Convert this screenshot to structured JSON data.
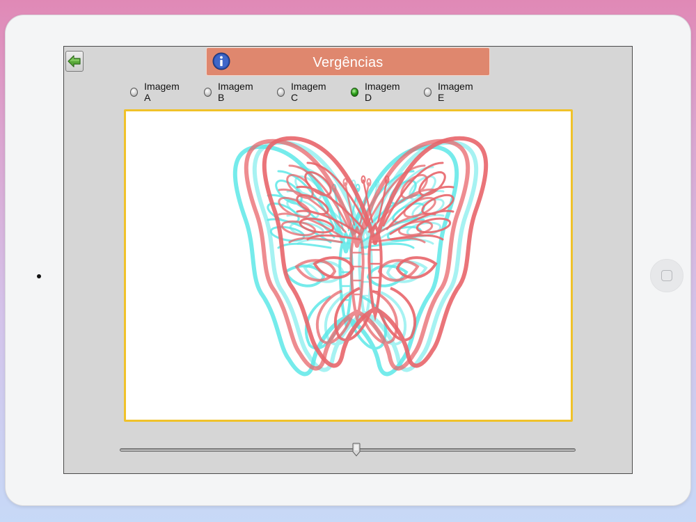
{
  "app": {
    "title": "Vergências"
  },
  "image_options": [
    {
      "label": "Imagem A",
      "selected": false
    },
    {
      "label": "Imagem B",
      "selected": false
    },
    {
      "label": "Imagem C",
      "selected": false
    },
    {
      "label": "Imagem D",
      "selected": true
    },
    {
      "label": "Imagem E",
      "selected": false
    }
  ],
  "image_view": {
    "subject": "anaglyph-butterfly",
    "colors": {
      "red_layer": "#e8666b",
      "cyan_layer": "#5ee8e8",
      "frame_border": "#f0c22a"
    }
  },
  "slider": {
    "value": 0.52
  },
  "icons": {
    "back": "back-arrow-icon",
    "info": "info-icon"
  },
  "colors": {
    "title_bar": "#df876e",
    "screen_bg": "#d6d6d6",
    "selected_radio": "#2fa21c"
  }
}
